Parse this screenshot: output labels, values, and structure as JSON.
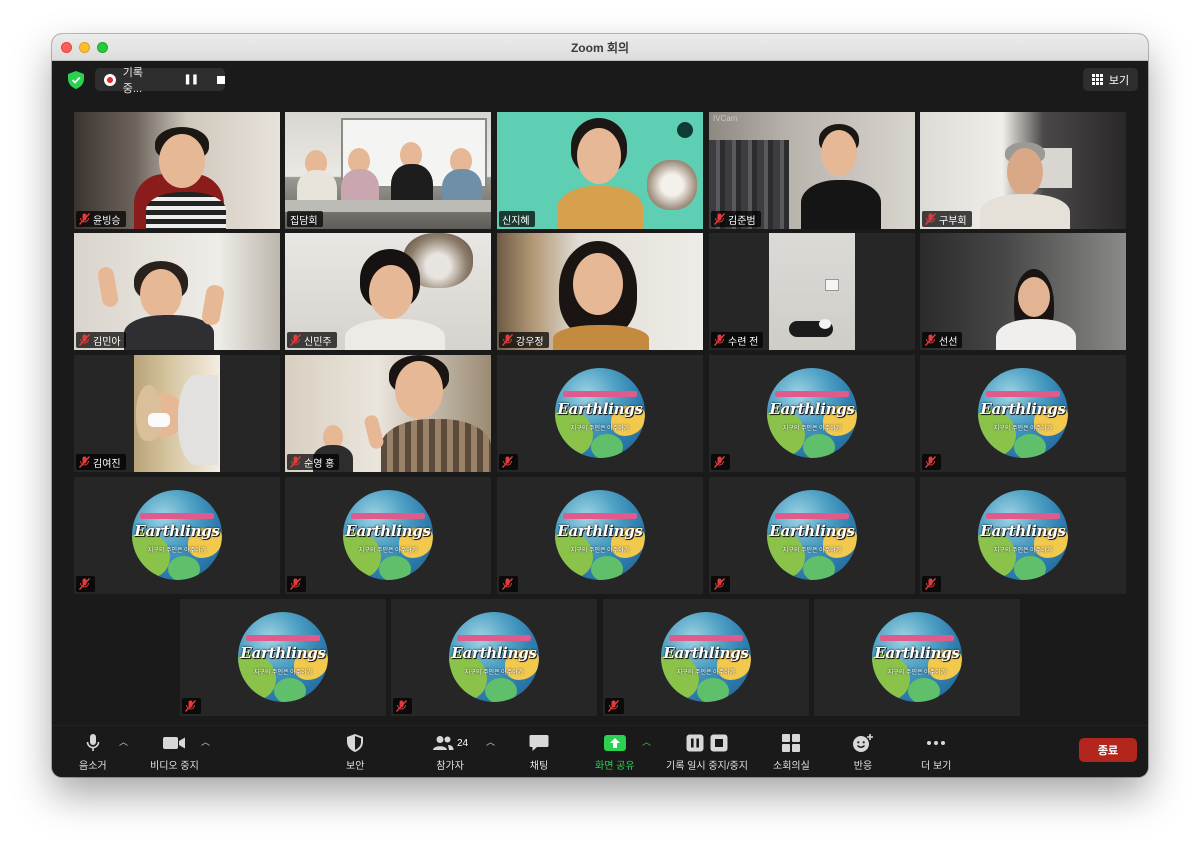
{
  "window": {
    "title": "Zoom 회의"
  },
  "topbar": {
    "recording_label": "기록 중...",
    "view_label": "보기"
  },
  "participants": [
    {
      "name": "윤빙승",
      "muted": true
    },
    {
      "name": "집담회",
      "muted": false
    },
    {
      "name": "신지혜",
      "muted": false
    },
    {
      "name": "김준범",
      "muted": true
    },
    {
      "name": "구부회",
      "muted": true
    },
    {
      "name": "김민아",
      "muted": true
    },
    {
      "name": "신민주",
      "muted": true
    },
    {
      "name": "강우정",
      "muted": true
    },
    {
      "name": "수련 전",
      "muted": true
    },
    {
      "name": "선선",
      "muted": true
    },
    {
      "name": "김여진",
      "muted": true
    },
    {
      "name": "순영 홍",
      "muted": true
    }
  ],
  "tile_overlays": {
    "cam_tag": "IVCam"
  },
  "logo": {
    "word": "Earthlings",
    "subtitle": "지구의 주인은 아주아가"
  },
  "toolbar": {
    "mute_label": "음소거",
    "video_label": "비디오 중지",
    "security_label": "보안",
    "participants_label": "참가자",
    "participants_count": "24",
    "chat_label": "채팅",
    "share_label": "화면 공유",
    "record_label": "기록 일시 중지/중지",
    "breakout_label": "소회의실",
    "reactions_label": "반응",
    "more_label": "더 보기",
    "end_label": "종료"
  },
  "colors": {
    "active_speaker": "#d4e157",
    "share_green": "#2bd24f",
    "end_red": "#b3261e"
  }
}
